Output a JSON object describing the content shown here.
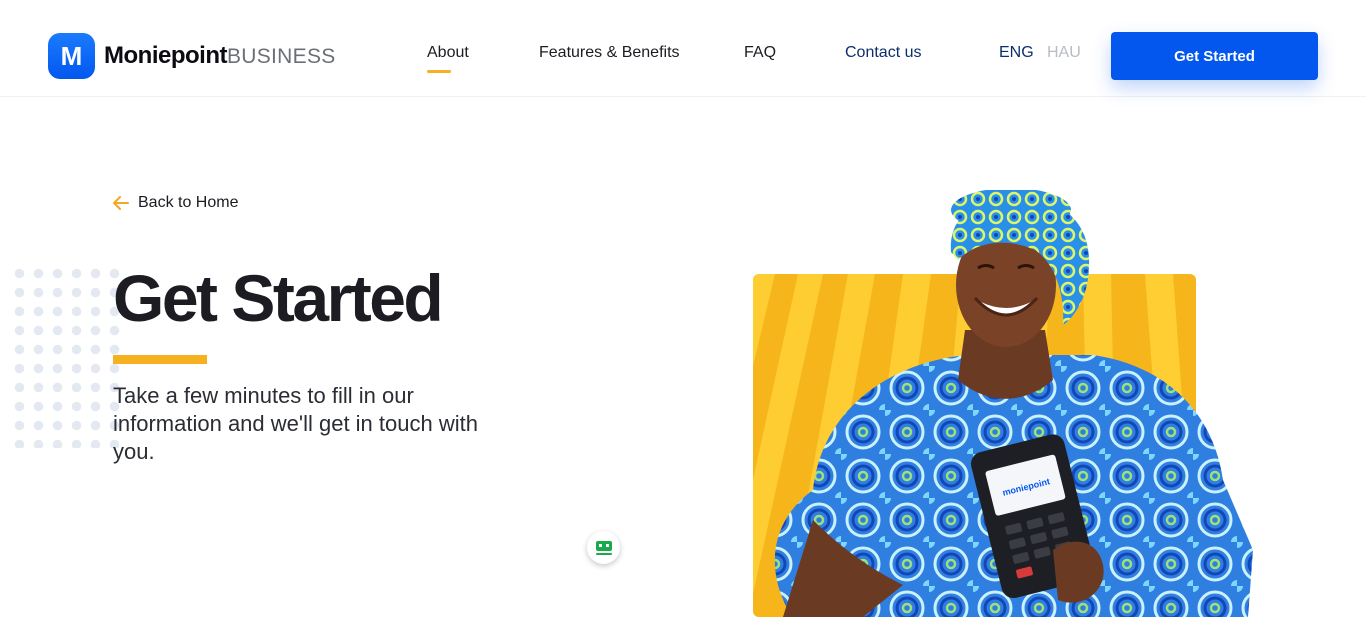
{
  "brand": {
    "logo_letter": "M",
    "name_bold": "Moniepoint",
    "name_light": "BUSINESS",
    "primary_color": "#0357ee",
    "accent_color": "#f5b120"
  },
  "nav": {
    "items": [
      {
        "label": "About",
        "active": true
      },
      {
        "label": "Features & Benefits",
        "active": false
      },
      {
        "label": "FAQ",
        "active": false
      },
      {
        "label": "Contact us",
        "active": false
      }
    ],
    "languages": [
      {
        "label": "ENG",
        "active": true
      },
      {
        "label": "HAU",
        "active": false
      }
    ],
    "cta_label": "Get Started"
  },
  "hero": {
    "back_label": "Back to Home",
    "back_icon": "arrow-left-icon",
    "title": "Get Started",
    "description": "Take a few minutes to fill in our information and we'll get in touch with you."
  },
  "widget": {
    "icon": "chat-bot-icon"
  },
  "illustration": {
    "terminal_brand": "moniepoint"
  }
}
